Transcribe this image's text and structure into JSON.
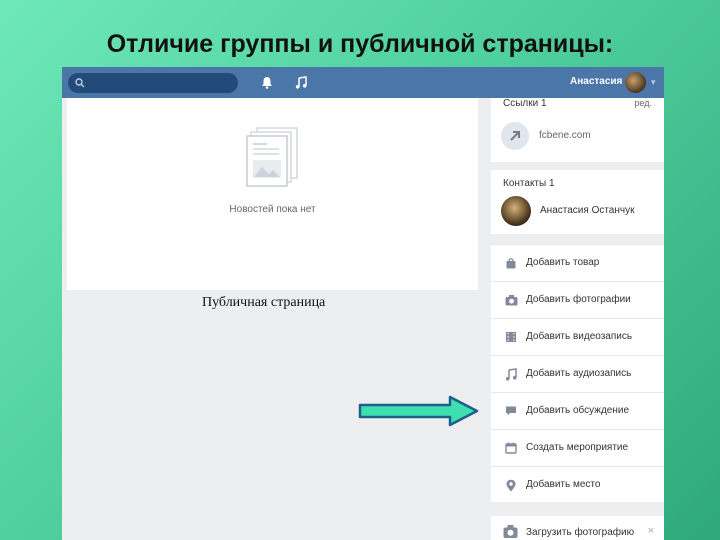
{
  "slide": {
    "title": "Отличие группы и публичной страницы:",
    "caption": "Публичная страница"
  },
  "topbar": {
    "search_placeholder": "",
    "user_name": "Анастасия",
    "caret": "▾"
  },
  "feed": {
    "empty_text": "Новостей пока нет"
  },
  "sidebar": {
    "links": {
      "header": "Ссылки 1",
      "edit_label": "ред.",
      "items": [
        {
          "text": "fcbene.com"
        }
      ]
    },
    "contacts": {
      "header": "Контакты 1",
      "items": [
        {
          "name": "Анастасия Останчук"
        }
      ]
    },
    "actions": [
      {
        "label": "Добавить товар",
        "icon": "bag-icon"
      },
      {
        "label": "Добавить фотографии",
        "icon": "camera-icon"
      },
      {
        "label": "Добавить видеозапись",
        "icon": "film-icon"
      },
      {
        "label": "Добавить аудиозапись",
        "icon": "music-note-icon"
      },
      {
        "label": "Добавить обсуждение",
        "icon": "chat-bubble-icon"
      },
      {
        "label": "Создать мероприятие",
        "icon": "calendar-icon"
      },
      {
        "label": "Добавить место",
        "icon": "map-pin-icon"
      }
    ],
    "upload": {
      "label": "Загрузить фотографию",
      "close": "×"
    }
  },
  "colors": {
    "topbar": "#4a76a8",
    "arrow_fill": "#3ee0b0",
    "arrow_stroke": "#1f5f8b",
    "icon": "#828a99"
  }
}
